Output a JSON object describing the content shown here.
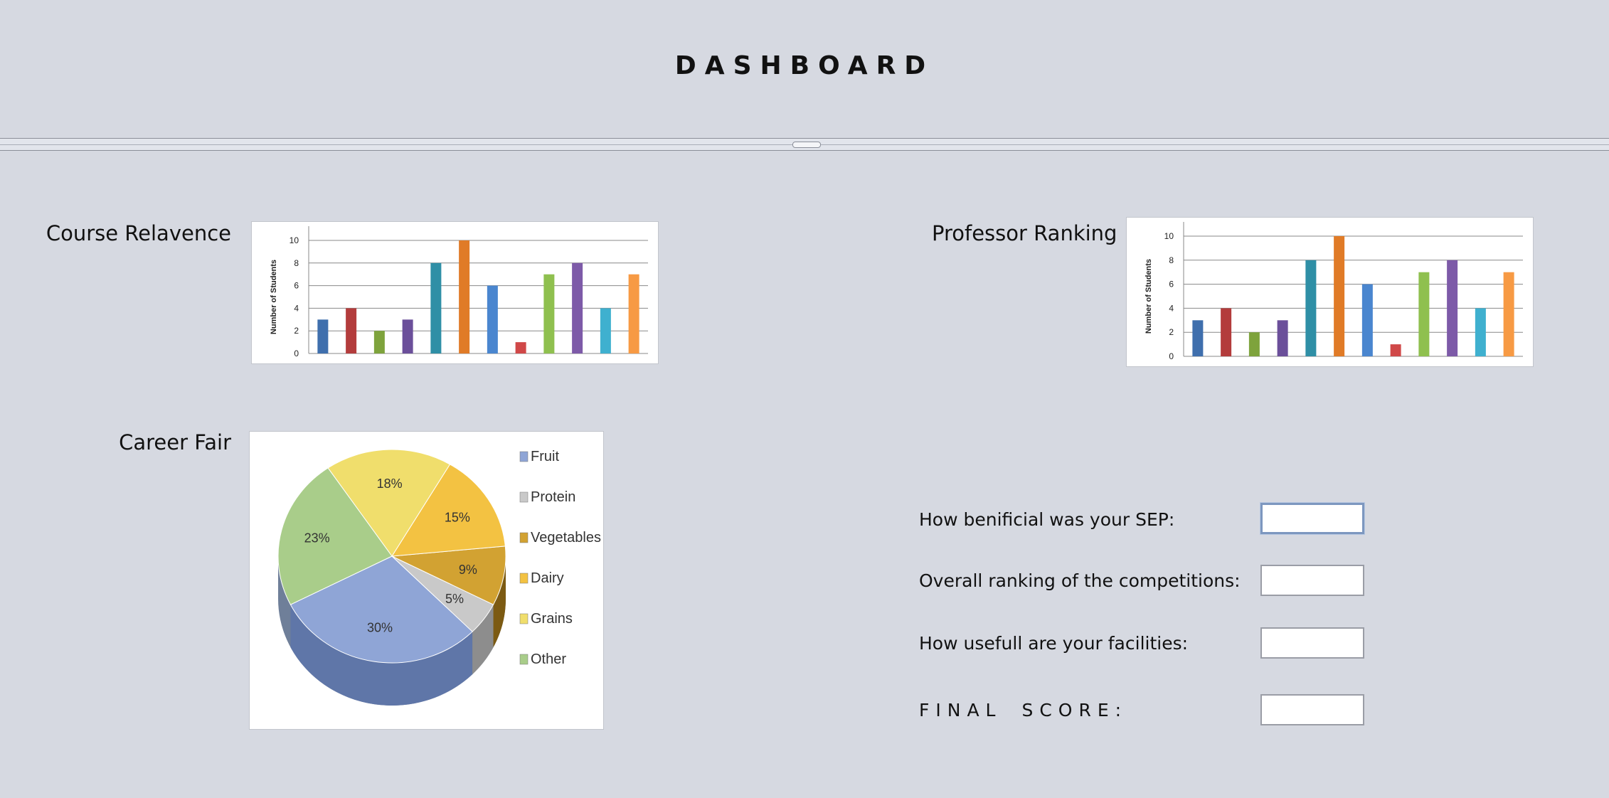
{
  "window": {
    "title": "DASHBOARD"
  },
  "charts": {
    "course_relevance": {
      "label": "Course Relavence",
      "chart_data": {
        "type": "bar",
        "ylabel": "Number of Students",
        "ylim": [
          0,
          10
        ],
        "yticks": [
          "0",
          "2",
          "4",
          "6",
          "8",
          "10"
        ],
        "values": [
          3,
          4,
          2,
          3,
          8,
          10,
          6,
          1,
          7,
          8,
          4,
          7
        ],
        "colors": [
          "#3f6fad",
          "#b33c3c",
          "#7ea33c",
          "#6b4f9a",
          "#2f8fa6",
          "#e07b27",
          "#4a86cf",
          "#d04848",
          "#8fc04f",
          "#7d5aa8",
          "#3fb0cf",
          "#f79a44"
        ],
        "grid": true
      }
    },
    "professor_ranking": {
      "label": "Professor Ranking",
      "chart_data": {
        "type": "bar",
        "ylabel": "Number of Students",
        "ylim": [
          0,
          10
        ],
        "yticks": [
          "0",
          "2",
          "4",
          "6",
          "8",
          "10"
        ],
        "values": [
          3,
          4,
          2,
          3,
          8,
          10,
          6,
          1,
          7,
          8,
          4,
          7
        ],
        "colors": [
          "#3f6fad",
          "#b33c3c",
          "#7ea33c",
          "#6b4f9a",
          "#2f8fa6",
          "#e07b27",
          "#4a86cf",
          "#d04848",
          "#8fc04f",
          "#7d5aa8",
          "#3fb0cf",
          "#f79a44"
        ],
        "grid": true
      }
    },
    "career_fair": {
      "label": "Career Fair",
      "chart_data": {
        "type": "pie",
        "slices": [
          {
            "name": "Fruit",
            "value": 30,
            "label": "30%",
            "color": "#8fa5d6"
          },
          {
            "name": "Protein",
            "value": 5,
            "label": "5%",
            "color": "#c9c9c9"
          },
          {
            "name": "Vegetables",
            "value": 9,
            "label": "9%",
            "color": "#d2a232"
          },
          {
            "name": "Dairy",
            "value": 15,
            "label": "15%",
            "color": "#f3c242"
          },
          {
            "name": "Grains",
            "value": 18,
            "label": "18%",
            "color": "#f0de6c"
          },
          {
            "name": "Other",
            "value": 23,
            "label": "23%",
            "color": "#a9cd8a"
          }
        ],
        "legend": [
          "Fruit",
          "Protein",
          "Vegetables",
          "Dairy",
          "Grains",
          "Other"
        ],
        "legend_placement": "right"
      }
    }
  },
  "form": {
    "q1": {
      "label": "How benificial was your SEP:",
      "value": ""
    },
    "q2": {
      "label": "Overall ranking of the competitions:",
      "value": ""
    },
    "q3": {
      "label": "How usefull are your facilities:",
      "value": ""
    },
    "final": {
      "label_word1": "FINAL",
      "label_word2": "SCORE:",
      "value": ""
    }
  }
}
